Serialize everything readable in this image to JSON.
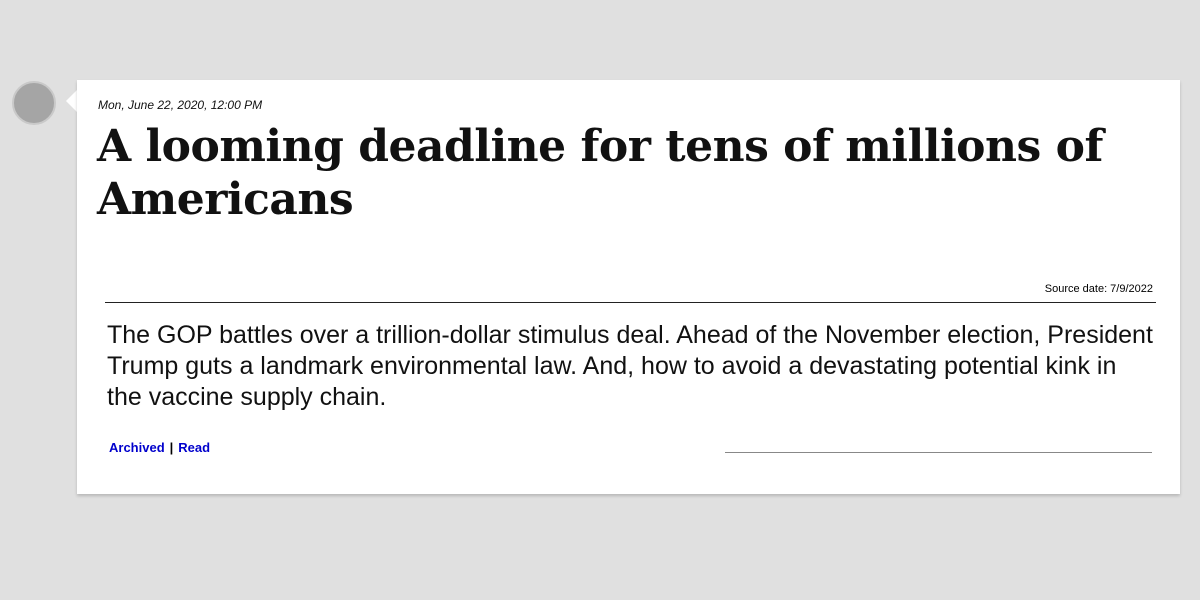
{
  "post": {
    "timestamp": "Mon, June 22, 2020, 12:00 PM",
    "headline": "A looming deadline for tens of millions of Americans",
    "source_date": "Source date: 7/9/2022",
    "summary": "The GOP battles over a trillion-dollar stimulus deal. Ahead of the November election, President Trump guts a landmark environmental law. And, how to avoid a devastating potential kink in the vaccine supply chain."
  },
  "links": {
    "archived_label": "Archived",
    "separator": "|",
    "read_label": "Read"
  },
  "colors": {
    "page_background": "#e0e0e0",
    "card_background": "#ffffff",
    "link": "#0000cc",
    "avatar": "#a5a5a5"
  }
}
